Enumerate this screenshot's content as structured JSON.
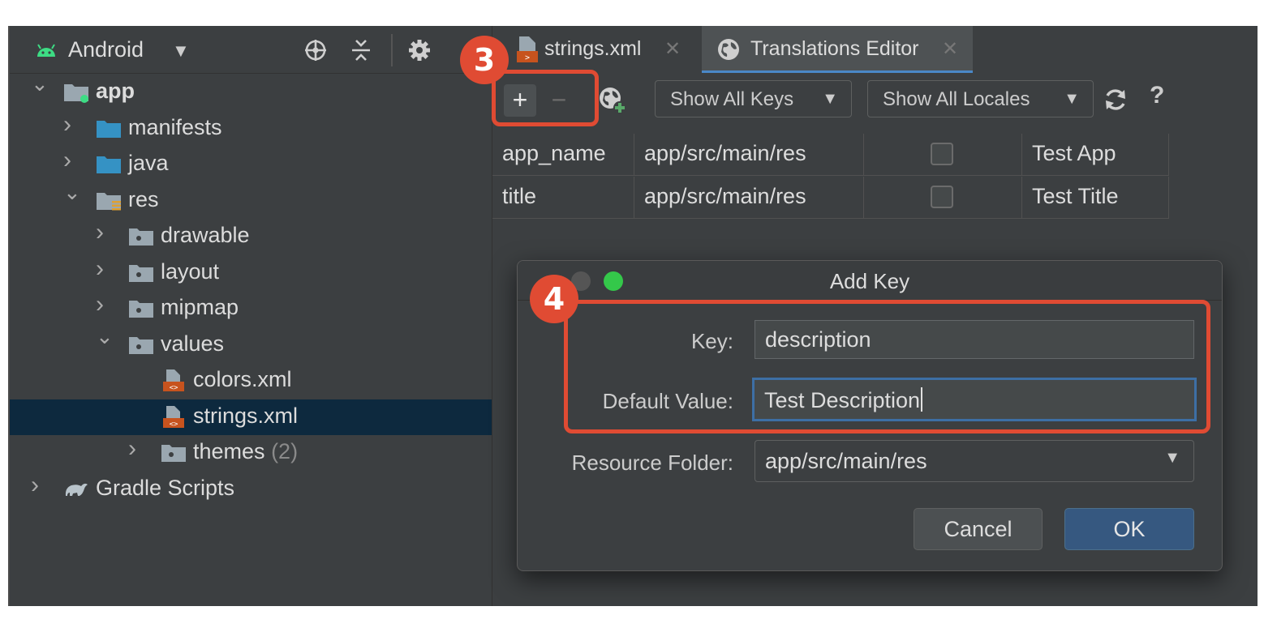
{
  "project_panel": {
    "title": "Android",
    "tree": [
      {
        "label": "app",
        "count": "",
        "indent": 0,
        "expanded": true,
        "icon": "module-folder-icon",
        "bold": true
      },
      {
        "label": "manifests",
        "count": "",
        "indent": 1,
        "expanded": false,
        "icon": "folder-icon"
      },
      {
        "label": "java",
        "count": "",
        "indent": 1,
        "expanded": false,
        "icon": "folder-icon"
      },
      {
        "label": "res",
        "count": "",
        "indent": 1,
        "expanded": true,
        "icon": "res-folder-icon"
      },
      {
        "label": "drawable",
        "count": "",
        "indent": 2,
        "expanded": false,
        "icon": "package-folder-icon"
      },
      {
        "label": "layout",
        "count": "",
        "indent": 2,
        "expanded": false,
        "icon": "package-folder-icon"
      },
      {
        "label": "mipmap",
        "count": "",
        "indent": 2,
        "expanded": false,
        "icon": "package-folder-icon"
      },
      {
        "label": "values",
        "count": "",
        "indent": 2,
        "expanded": true,
        "icon": "package-folder-icon"
      },
      {
        "label": "colors.xml",
        "count": "",
        "indent": 3,
        "leaf": true,
        "icon": "xml-file-icon"
      },
      {
        "label": "strings.xml",
        "count": "",
        "indent": 3,
        "leaf": true,
        "icon": "xml-file-icon",
        "selected": true
      },
      {
        "label": "themes",
        "count": "(2)",
        "indent": 3,
        "expanded": false,
        "icon": "package-folder-icon"
      },
      {
        "label": "Gradle Scripts",
        "count": "",
        "indent": 0,
        "expanded": false,
        "icon": "gradle-icon"
      }
    ]
  },
  "tabs": [
    {
      "label": "strings.xml",
      "icon": "xml-file-icon",
      "active": false
    },
    {
      "label": "Translations Editor",
      "icon": "globe-icon",
      "active": true
    }
  ],
  "toolbar": {
    "add_key": "+",
    "remove_key": "−",
    "keys_filter": "Show All Keys",
    "locales_filter": "Show All Locales",
    "help": "?"
  },
  "table": {
    "rows": [
      {
        "key": "app_name",
        "resource_folder": "app/src/main/res",
        "untranslatable": false,
        "default_value": "Test App"
      },
      {
        "key": "title",
        "resource_folder": "app/src/main/res",
        "untranslatable": false,
        "default_value": "Test Title"
      }
    ]
  },
  "dialog": {
    "title": "Add Key",
    "key_label": "Key:",
    "key_value": "description",
    "default_value_label": "Default Value:",
    "default_value": "Test Description",
    "resource_folder_label": "Resource Folder:",
    "resource_folder_value": "app/src/main/res",
    "cancel": "Cancel",
    "ok": "OK"
  },
  "annotations": {
    "step_toolbar": "3",
    "step_dialog": "4",
    "highlight_color": "#e04b33"
  },
  "colors": {
    "accent": "#4a88c7",
    "selection": "#0d293e",
    "android_green": "#3ddc84"
  }
}
